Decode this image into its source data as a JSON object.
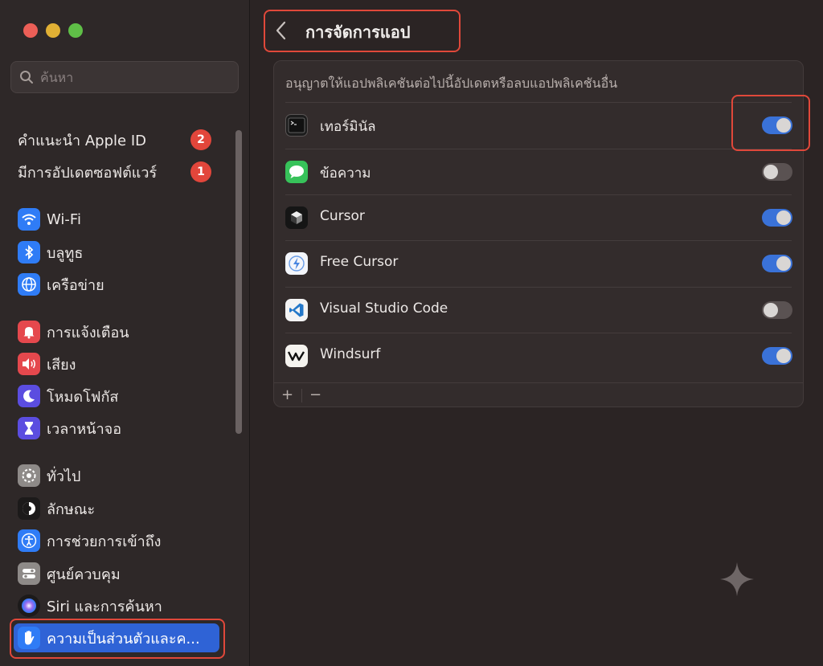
{
  "window": {
    "traffic_lights": [
      "close",
      "minimize",
      "maximize"
    ]
  },
  "sidebar": {
    "search_placeholder": "ค้นหา",
    "account_items": [
      {
        "label": "คำแนะนำ Apple ID",
        "badge": "2"
      },
      {
        "label": "มีการอัปเดตซอฟต์แวร์",
        "badge": "1"
      }
    ],
    "items": [
      {
        "label": "Wi-Fi",
        "icon": "wifi-icon",
        "color": "#2f7cf6"
      },
      {
        "label": "บลูทูธ",
        "icon": "bluetooth-icon",
        "color": "#2f7cf6"
      },
      {
        "label": "เครือข่าย",
        "icon": "globe-icon",
        "color": "#2f7cf6"
      },
      {
        "label": "การแจ้งเตือน",
        "icon": "bell-icon",
        "color": "#e5484d"
      },
      {
        "label": "เสียง",
        "icon": "speaker-icon",
        "color": "#e5484d"
      },
      {
        "label": "โหมดโฟกัส",
        "icon": "moon-icon",
        "color": "#5b4de0"
      },
      {
        "label": "เวลาหน้าจอ",
        "icon": "hourglass-icon",
        "color": "#5b4de0"
      },
      {
        "label": "ทั่วไป",
        "icon": "gear-icon",
        "color": "#8e8a88"
      },
      {
        "label": "ลักษณะ",
        "icon": "appearance-icon",
        "color": "#1c1a1a"
      },
      {
        "label": "การช่วยการเข้าถึง",
        "icon": "accessibility-icon",
        "color": "#2f7cf6"
      },
      {
        "label": "ศูนย์ควบคุม",
        "icon": "control-center-icon",
        "color": "#8e8a88"
      },
      {
        "label": "Siri และการค้นหา",
        "icon": "siri-icon",
        "color": "#1c1a1a"
      },
      {
        "label": "ความเป็นส่วนตัวและค...",
        "icon": "hand-icon",
        "color": "#2f7cf6",
        "selected": true
      }
    ]
  },
  "main": {
    "title": "การจัดการแอป",
    "description": "อนุญาตให้แอปพลิเคชันต่อไปนี้อัปเดตหรือลบแอปพลิเคชันอื่น",
    "apps": [
      {
        "name": "เทอร์มินัล",
        "icon": "terminal-icon",
        "enabled": true
      },
      {
        "name": "ข้อความ",
        "icon": "messages-icon",
        "enabled": false
      },
      {
        "name": "Cursor",
        "icon": "cursor-app-icon",
        "enabled": true
      },
      {
        "name": "Free Cursor",
        "icon": "free-cursor-app-icon",
        "enabled": true
      },
      {
        "name": "Visual Studio Code",
        "icon": "vscode-icon",
        "enabled": false
      },
      {
        "name": "Windsurf",
        "icon": "windsurf-icon",
        "enabled": true
      }
    ],
    "footer": {
      "add_label": "+",
      "remove_label": "−"
    }
  },
  "colors": {
    "accent": "#3a72d8",
    "highlight": "#e0483a",
    "badge": "#e2463b"
  }
}
